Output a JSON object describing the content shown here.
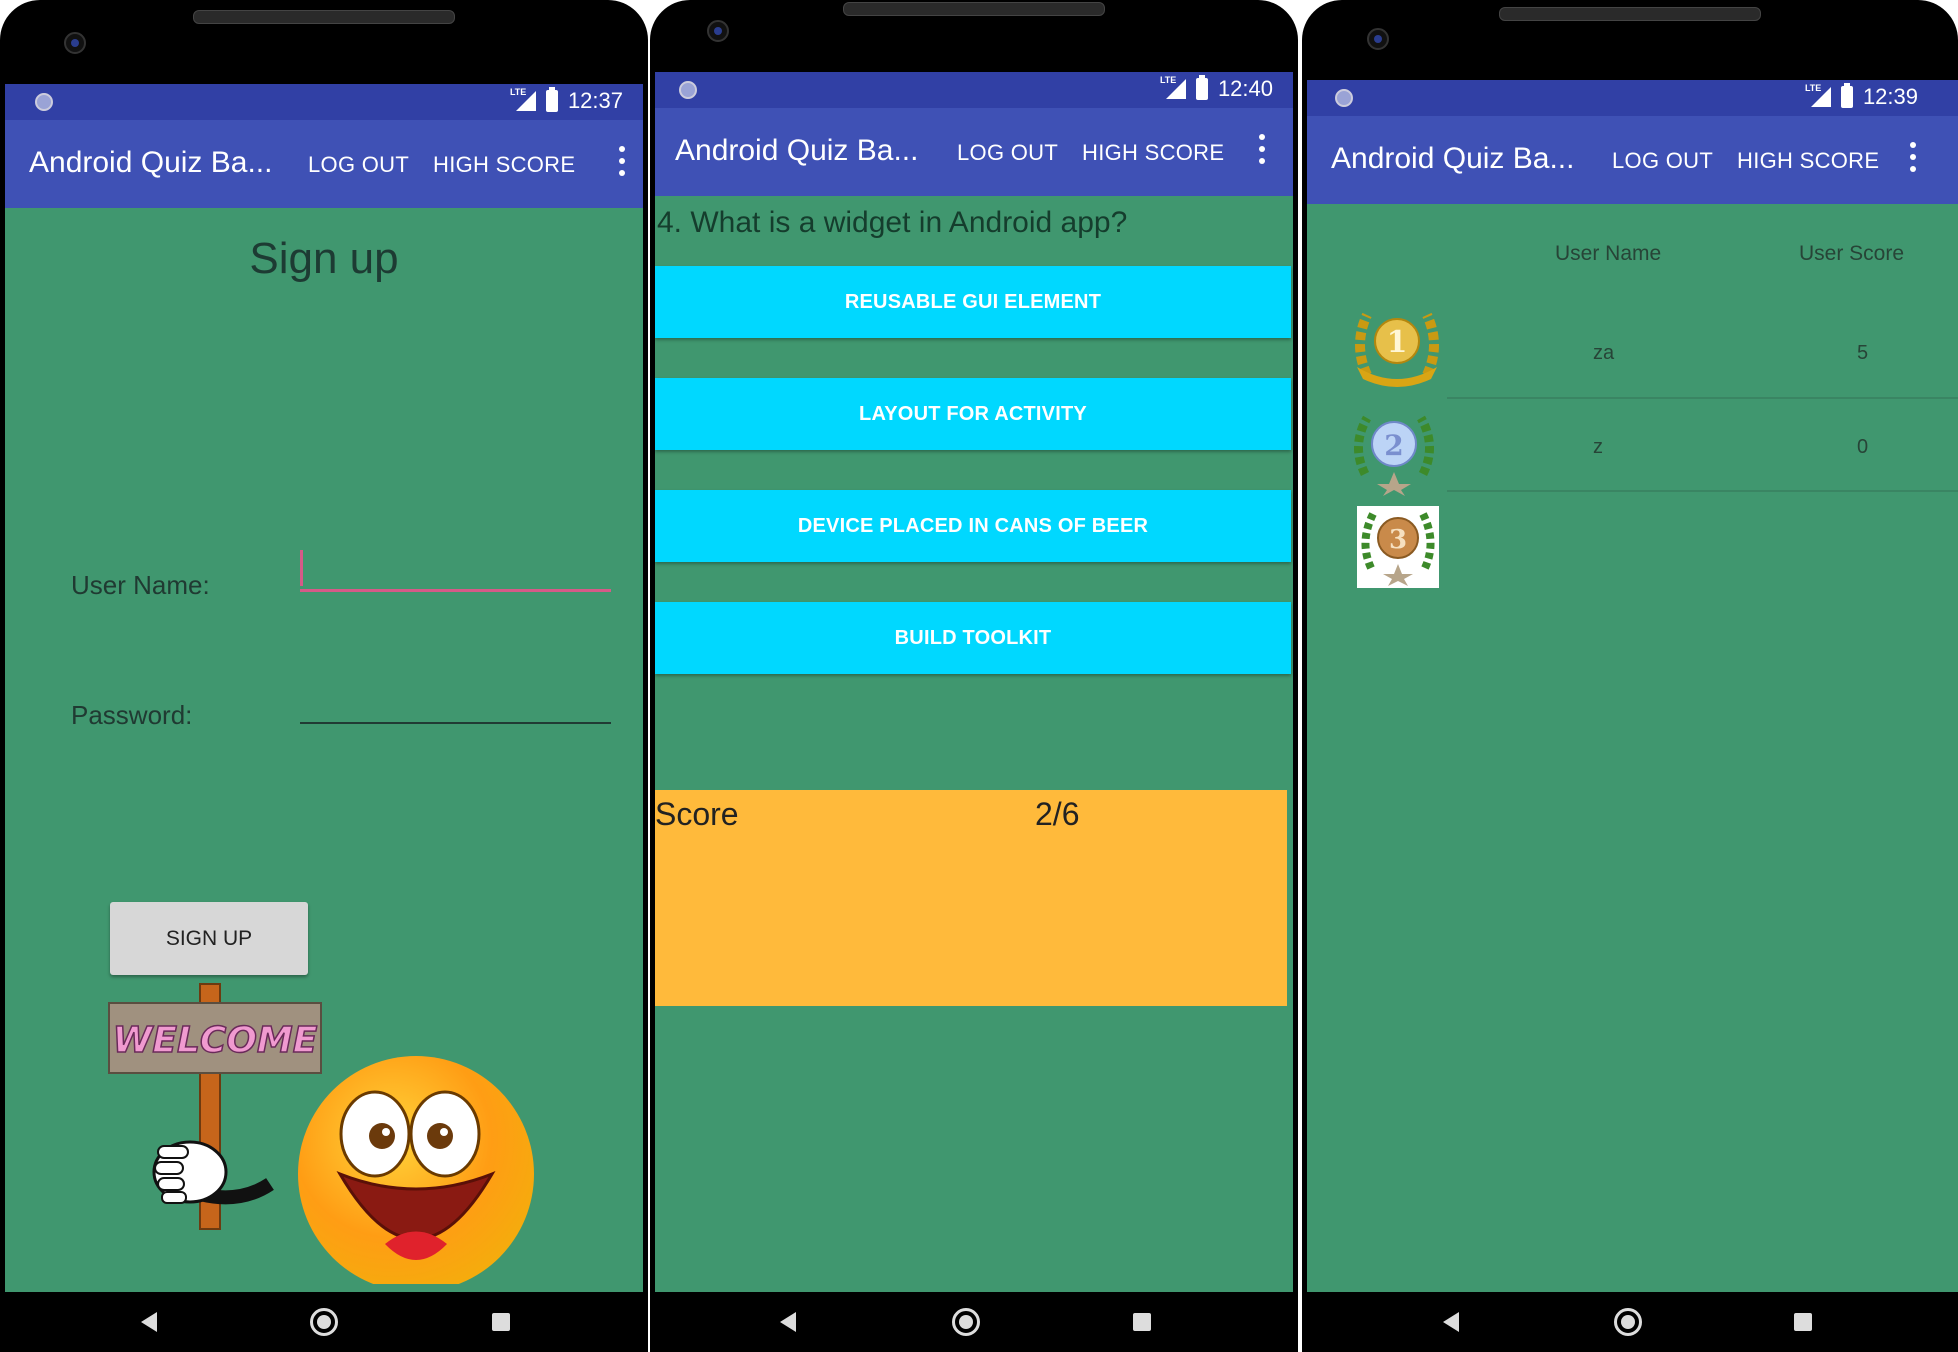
{
  "app": {
    "title": "Android Quiz Ba...",
    "logout_label": "LOG OUT",
    "highscore_label": "HIGH SCORE",
    "status_lte": "LTE"
  },
  "screens": [
    {
      "time": "12:37",
      "heading": "Sign up",
      "username_label": "User Name:",
      "password_label": "Password:",
      "username_value": "",
      "password_value": "",
      "signup_button": "SIGN UP",
      "welcome_sign": "WELCOME"
    },
    {
      "time": "12:40",
      "question": "4. What is a widget in Android app?",
      "answers": [
        "REUSABLE GUI ELEMENT",
        "LAYOUT FOR ACTIVITY",
        "DEVICE PLACED IN CANS OF BEER",
        "BUILD TOOLKIT"
      ],
      "score_label": "Score",
      "score_value": "2/6"
    },
    {
      "time": "12:39",
      "header_user": "User Name",
      "header_score": "User Score",
      "rows": [
        {
          "rank": "1",
          "name": "za",
          "score": "5"
        },
        {
          "rank": "2",
          "name": "z",
          "score": "0"
        },
        {
          "rank": "3",
          "name": "",
          "score": ""
        }
      ]
    }
  ],
  "colors": {
    "primary": "#3f51b5",
    "status": "#3140a5",
    "background": "#40976f",
    "answer": "#00d8ff",
    "score_panel": "#ffba3b",
    "accent": "#d65a88"
  }
}
